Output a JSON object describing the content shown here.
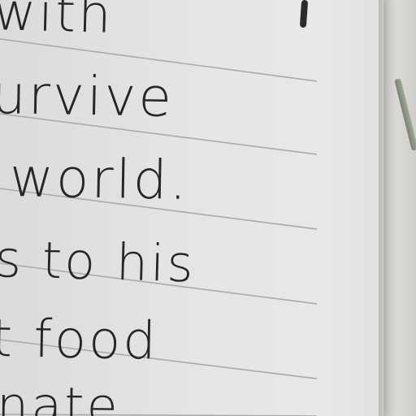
{
  "lines_of_text": [
    "with",
    "urvive",
    "world.",
    "s to his",
    "t food",
    "nate"
  ],
  "colors": {
    "paper": "#e6e5e3",
    "ink": "#262527",
    "rule": "#aaa9b0"
  }
}
